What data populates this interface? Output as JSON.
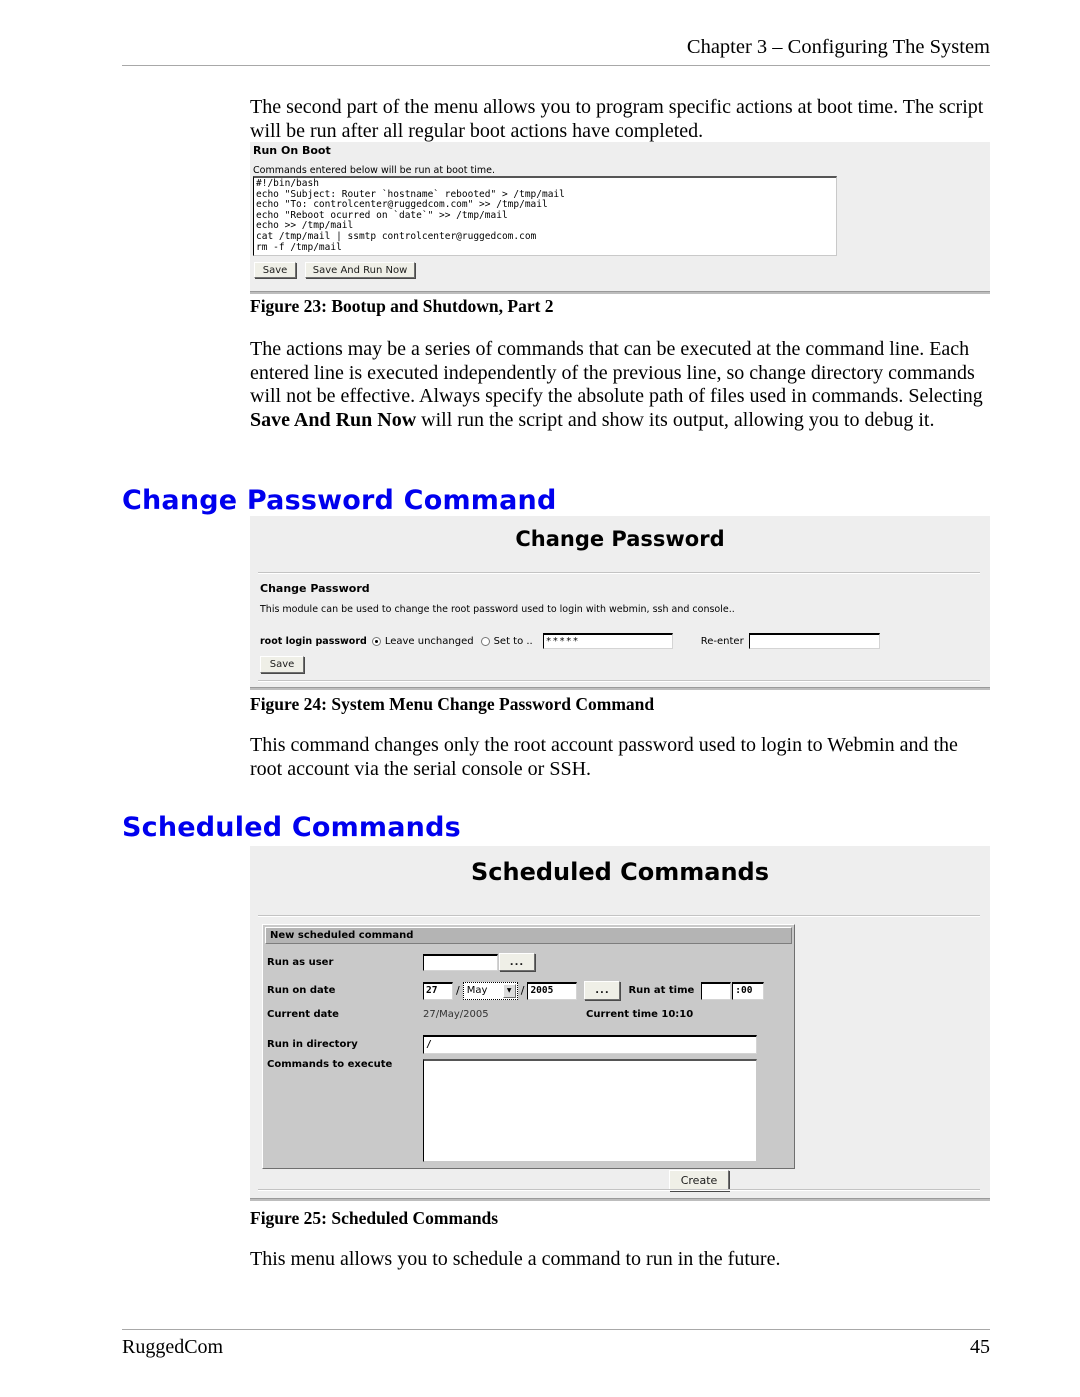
{
  "header": {
    "chapter": "Chapter 3 – Configuring The System"
  },
  "intro_paragraph": "The second part of the menu allows you to program specific actions at boot time.  The script will be run after all regular boot actions have completed.",
  "run_on_boot": {
    "title": "Run On Boot",
    "description": "Commands entered below will be run at boot time.",
    "script": "#!/bin/bash\necho \"Subject: Router `hostname` rebooted\" > /tmp/mail\necho \"To: controlcenter@ruggedcom.com\" >> /tmp/mail\necho \"Reboot ocurred on `date`\" >> /tmp/mail\necho >> /tmp/mail\ncat /tmp/mail | ssmtp controlcenter@ruggedcom.com\nrm -f /tmp/mail",
    "save_label": "Save",
    "save_run_label": "Save And Run Now"
  },
  "figure23_caption": "Figure 23: Bootup and Shutdown, Part 2",
  "paragraph_actions": "The actions may be a series of commands that can be executed at the command line.  Each entered line is executed independently of the previous line, so change directory commands will not be effective.  Always specify the absolute path of files used in commands.   Selecting ",
  "paragraph_actions_bold": "Save And Run Now",
  "paragraph_actions_tail": " will run the script and show its output, allowing you to debug it.",
  "section_change_password": "Change Password Command",
  "change_password": {
    "page_title": "Change Password",
    "subhead": "Change Password",
    "description": "This module can be used to change the root password used to login with webmin, ssh and console..",
    "field_label": "root login password",
    "option_leave": "Leave unchanged",
    "option_setto": "Set to ..",
    "password_value": "*****",
    "reenter_label": "Re-enter",
    "reenter_value": "",
    "save_label": "Save",
    "selected_option": "leave_unchanged"
  },
  "figure24_caption": "Figure 24: System Menu Change Password Command",
  "paragraph_changepw": "This command changes only the root account password used to login to Webmin and the root account via the serial console or SSH.",
  "section_scheduled_commands": "Scheduled Commands",
  "scheduled_commands": {
    "page_title": "Scheduled Commands",
    "panel_header": "New scheduled command",
    "run_as_user_label": "Run as user",
    "run_as_user_value": "",
    "browse_button": "...",
    "run_on_date_label": "Run on date",
    "date_day": "27",
    "date_month": "May",
    "date_year": "2005",
    "date_browse": "...",
    "run_at_time_label": "Run at time",
    "time_hour": "",
    "time_minute": ":00",
    "current_date_label": "Current date",
    "current_date_value": "27/May/2005",
    "current_time_label": "Current time 10:10",
    "run_in_directory_label": "Run in directory",
    "run_in_directory_value": "/",
    "commands_to_execute_label": "Commands to execute",
    "commands_to_execute_value": "",
    "create_label": "Create"
  },
  "figure25_caption": "Figure 25: Scheduled Commands",
  "paragraph_scheduled": "This menu allows you to schedule a command to run in the future.",
  "footer": {
    "company": "RuggedCom",
    "page_number": "45"
  },
  "colors": {
    "heading_blue": "#0000ee",
    "screenshot_bg": "#eeeeee",
    "panel_gray": "#c9c9c9"
  }
}
